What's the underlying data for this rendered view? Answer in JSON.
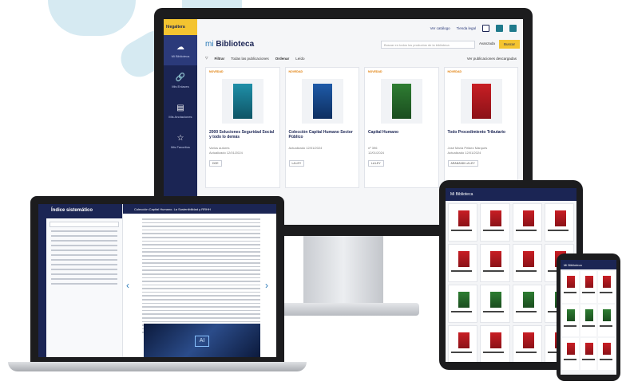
{
  "desktop": {
    "logo": "hlegaltera",
    "nav": [
      {
        "label": "Mi Biblioteca",
        "icon": "cloud-icon"
      },
      {
        "label": "Mis Enlaces",
        "icon": "link-icon"
      },
      {
        "label": "Mis Anotaciones",
        "icon": "note-icon"
      },
      {
        "label": "Mis Favoritos",
        "icon": "star-icon"
      }
    ],
    "top": {
      "link1": "Ver catálogo",
      "link2": "Tienda legal"
    },
    "title_prefix": "mi",
    "title": "Biblioteca",
    "search_placeholder": "Buscar en todos los productos de la biblioteca",
    "advanced": "Avanzada",
    "search_button": "Buscar",
    "filter_label": "Filtrar",
    "filter_value": "Todas las publicaciones",
    "order_label": "Ordenar",
    "order_value": "Leído",
    "downloads": "Ver publicaciones descargadas",
    "cards": [
      {
        "tag": "NOVEDAD",
        "title": "2000 Soluciones Seguridad Social y todo lo demás",
        "meta1": "Varios autores",
        "meta2": "Actualizado 12/01/2024",
        "badge": "DOE",
        "color": "teal"
      },
      {
        "tag": "NOVEDAD",
        "title": "Colección Capital Humano Sector Público",
        "meta1": "",
        "meta2": "Actualizado 12/01/2024",
        "badge": "LA LEY",
        "color": "blue"
      },
      {
        "tag": "NOVEDAD",
        "title": "Capital Humano",
        "meta1": "nº 396",
        "meta2": "12/01/2024",
        "badge": "LA LEY",
        "color": "green"
      },
      {
        "tag": "NOVEDAD",
        "title": "Todo Procedimiento Tributario",
        "meta1": "José María Peláez Marqués",
        "meta2": "Actualizado 12/01/2024",
        "badge": "ARANZADI LA LEY",
        "color": "red"
      }
    ]
  },
  "laptop": {
    "toc_title": "Índice sistemático",
    "topbar": "Colección Capital Humano. La Sostenibilidad y RRHH",
    "image_label": "AI"
  },
  "tablet": {
    "title": "Mi Biblioteca"
  },
  "phone": {
    "title": "Mi Biblioteca"
  }
}
